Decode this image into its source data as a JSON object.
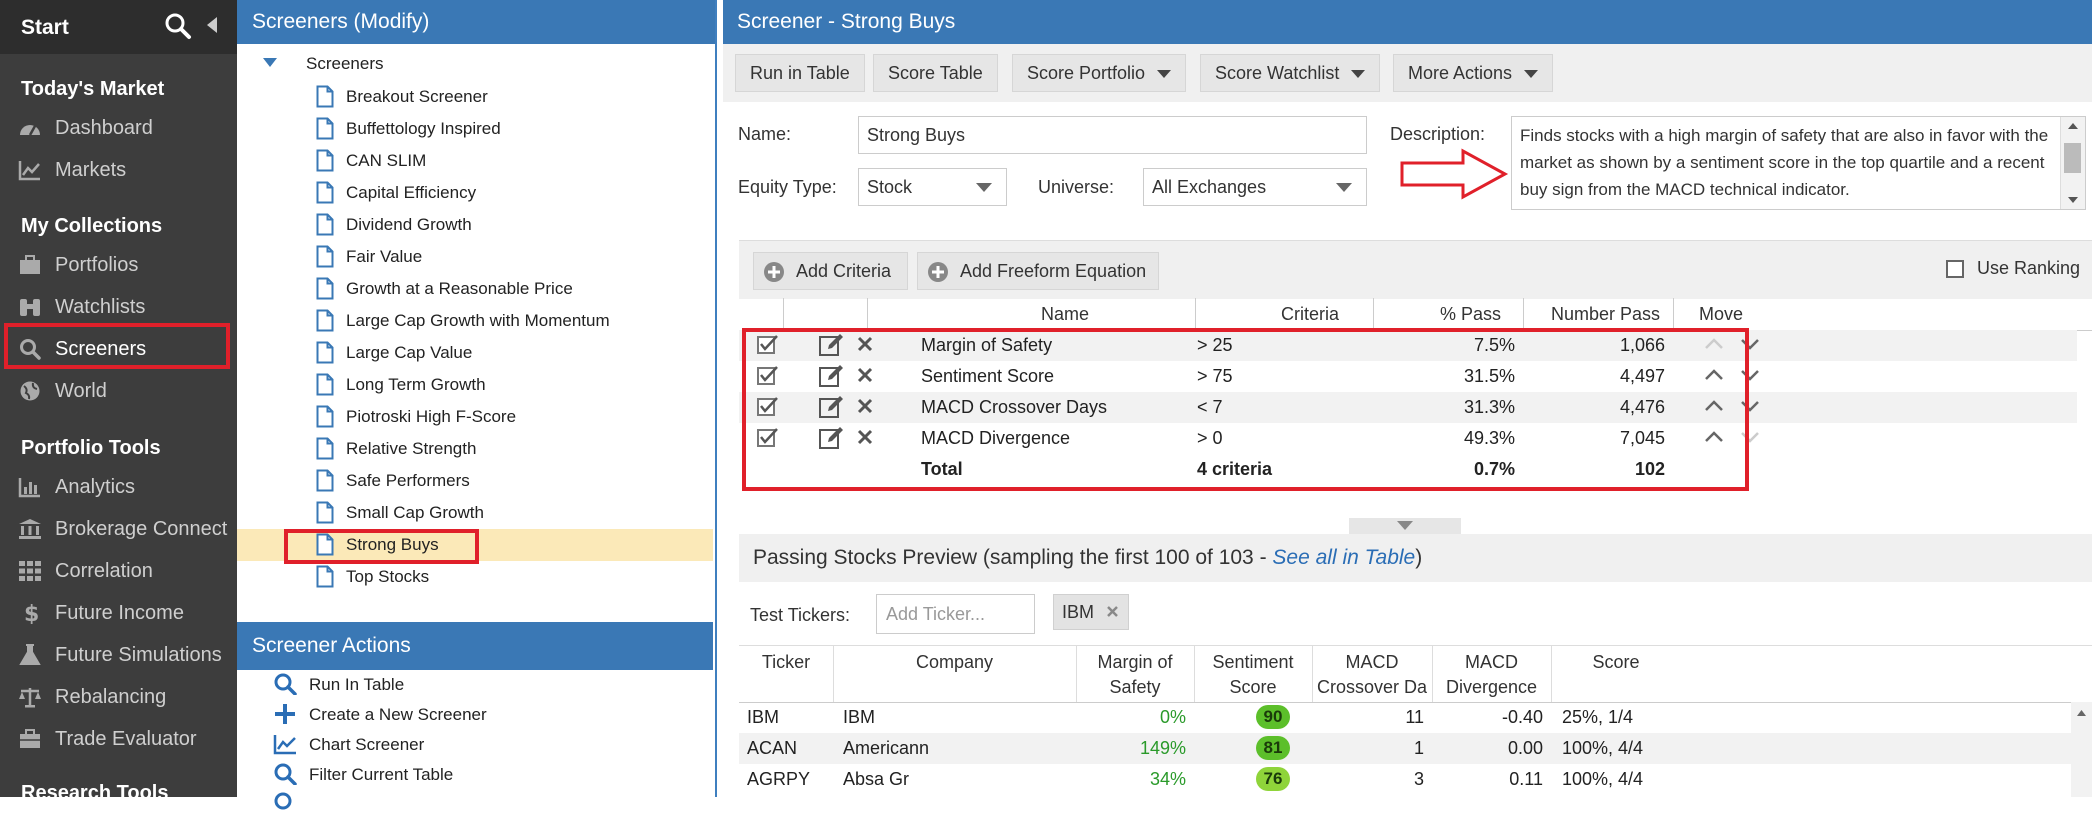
{
  "nav": {
    "title": "Start",
    "sections": {
      "todays_market": "Today's Market",
      "my_collections": "My Collections",
      "portfolio_tools": "Portfolio Tools",
      "research_tools": "Research Tools"
    },
    "items": {
      "dashboard": "Dashboard",
      "markets": "Markets",
      "portfolios": "Portfolios",
      "watchlists": "Watchlists",
      "screeners": "Screeners",
      "world": "World",
      "analytics": "Analytics",
      "brokerage_connect": "Brokerage Connect",
      "correlation": "Correlation",
      "future_income": "Future Income",
      "future_simulations": "Future Simulations",
      "rebalancing": "Rebalancing",
      "trade_evaluator": "Trade Evaluator"
    },
    "active": "Screeners"
  },
  "tree": {
    "header": "Screeners (Modify)",
    "root": "Screeners",
    "items": [
      "Breakout Screener",
      "Buffettology Inspired",
      "CAN SLIM",
      "Capital Efficiency",
      "Dividend Growth",
      "Fair Value",
      "Growth at a Reasonable Price",
      "Large Cap Growth with Momentum",
      "Large Cap Value",
      "Long Term Growth",
      "Piotroski High F-Score",
      "Relative Strength",
      "Safe Performers",
      "Small Cap Growth",
      "Strong Buys",
      "Top Stocks"
    ],
    "selected": "Strong Buys",
    "actions_header": "Screener Actions",
    "actions": {
      "run_in_table": "Run In Table",
      "create": "Create a New Screener",
      "chart": "Chart Screener",
      "filter": "Filter Current Table"
    }
  },
  "main": {
    "header": "Screener - Strong Buys",
    "toolbar": {
      "run_in_table": "Run in Table",
      "score_table": "Score Table",
      "score_portfolio": "Score Portfolio",
      "score_watchlist": "Score Watchlist",
      "more_actions": "More Actions"
    },
    "form": {
      "name_label": "Name:",
      "name_value": "Strong Buys",
      "equity_label": "Equity Type:",
      "equity_value": "Stock",
      "universe_label": "Universe:",
      "universe_value": "All Exchanges",
      "description_label": "Description:",
      "description_value": "Finds stocks with a high margin of safety that are also in favor with the market as shown by a sentiment score in the top quartile and a recent buy sign from the MACD technical indicator."
    },
    "criteria_bar": {
      "add_criteria": "Add Criteria",
      "add_freeform": "Add Freeform Equation",
      "use_ranking": "Use Ranking"
    },
    "criteria_columns": {
      "name": "Name",
      "criteria": "Criteria",
      "pct_pass": "% Pass",
      "number_pass": "Number Pass",
      "move": "Move"
    },
    "criteria_rows": [
      {
        "name": "Margin of Safety",
        "criteria": "> 25",
        "pct": "7.5%",
        "num": "1,066"
      },
      {
        "name": "Sentiment Score",
        "criteria": "> 75",
        "pct": "31.5%",
        "num": "4,497"
      },
      {
        "name": "MACD Crossover Days",
        "criteria": "< 7",
        "pct": "31.3%",
        "num": "4,476"
      },
      {
        "name": "MACD Divergence",
        "criteria": "> 0",
        "pct": "49.3%",
        "num": "7,045"
      }
    ],
    "criteria_total": {
      "label": "Total",
      "criteria": "4 criteria",
      "pct": "0.7%",
      "num": "102"
    },
    "preview": {
      "text_before": "Passing Stocks Preview (sampling the first 100 of 103 - ",
      "link": "See all in Table",
      "text_after": ")",
      "test_label": "Test Tickers:",
      "ticker_placeholder": "Add Ticker...",
      "test_tag": "IBM"
    },
    "result_columns": {
      "ticker": "Ticker",
      "company": "Company",
      "margin_1": "Margin of",
      "margin_2": "Safety",
      "sentiment_1": "Sentiment",
      "sentiment_2": "Score",
      "macd_cross_1": "MACD",
      "macd_cross_2": "Crossover Da",
      "macd_div_1": "MACD",
      "macd_div_2": "Divergence",
      "score": "Score"
    },
    "result_rows": [
      {
        "ticker": "IBM",
        "company": "IBM",
        "margin": "0%",
        "sentiment": "90",
        "crossover": "11",
        "divergence": "-0.40",
        "score": "25%, 1/4"
      },
      {
        "ticker": "ACAN",
        "company": "Americann",
        "margin": "149%",
        "sentiment": "81",
        "crossover": "1",
        "divergence": "0.00",
        "score": "100%, 4/4"
      },
      {
        "ticker": "AGRPY",
        "company": "Absa Gr",
        "margin": "34%",
        "sentiment": "76",
        "crossover": "3",
        "divergence": "0.11",
        "score": "100%, 4/4"
      }
    ]
  },
  "colors": {
    "nav_bg": "#3d3d3d",
    "header_blue": "#3a78b5",
    "highlight_red": "#e0202a",
    "selection_yellow": "#fbe9b8",
    "badge_green": "#5cbf2a",
    "positive_green": "#2a9a2a",
    "link_blue": "#2a6db5"
  },
  "icons": {
    "nav": [
      "dashboard-gauge-icon",
      "markets-chart-icon",
      "portfolios-briefcase-icon",
      "watchlists-binoculars-icon",
      "screeners-search-icon",
      "world-globe-icon",
      "analytics-bar-icon",
      "bank-icon",
      "grid-icon",
      "dollar-icon",
      "flask-icon",
      "scale-icon",
      "briefcase-icon"
    ],
    "tree": "document-icon",
    "arrow": "red-outline-arrow-icon"
  }
}
